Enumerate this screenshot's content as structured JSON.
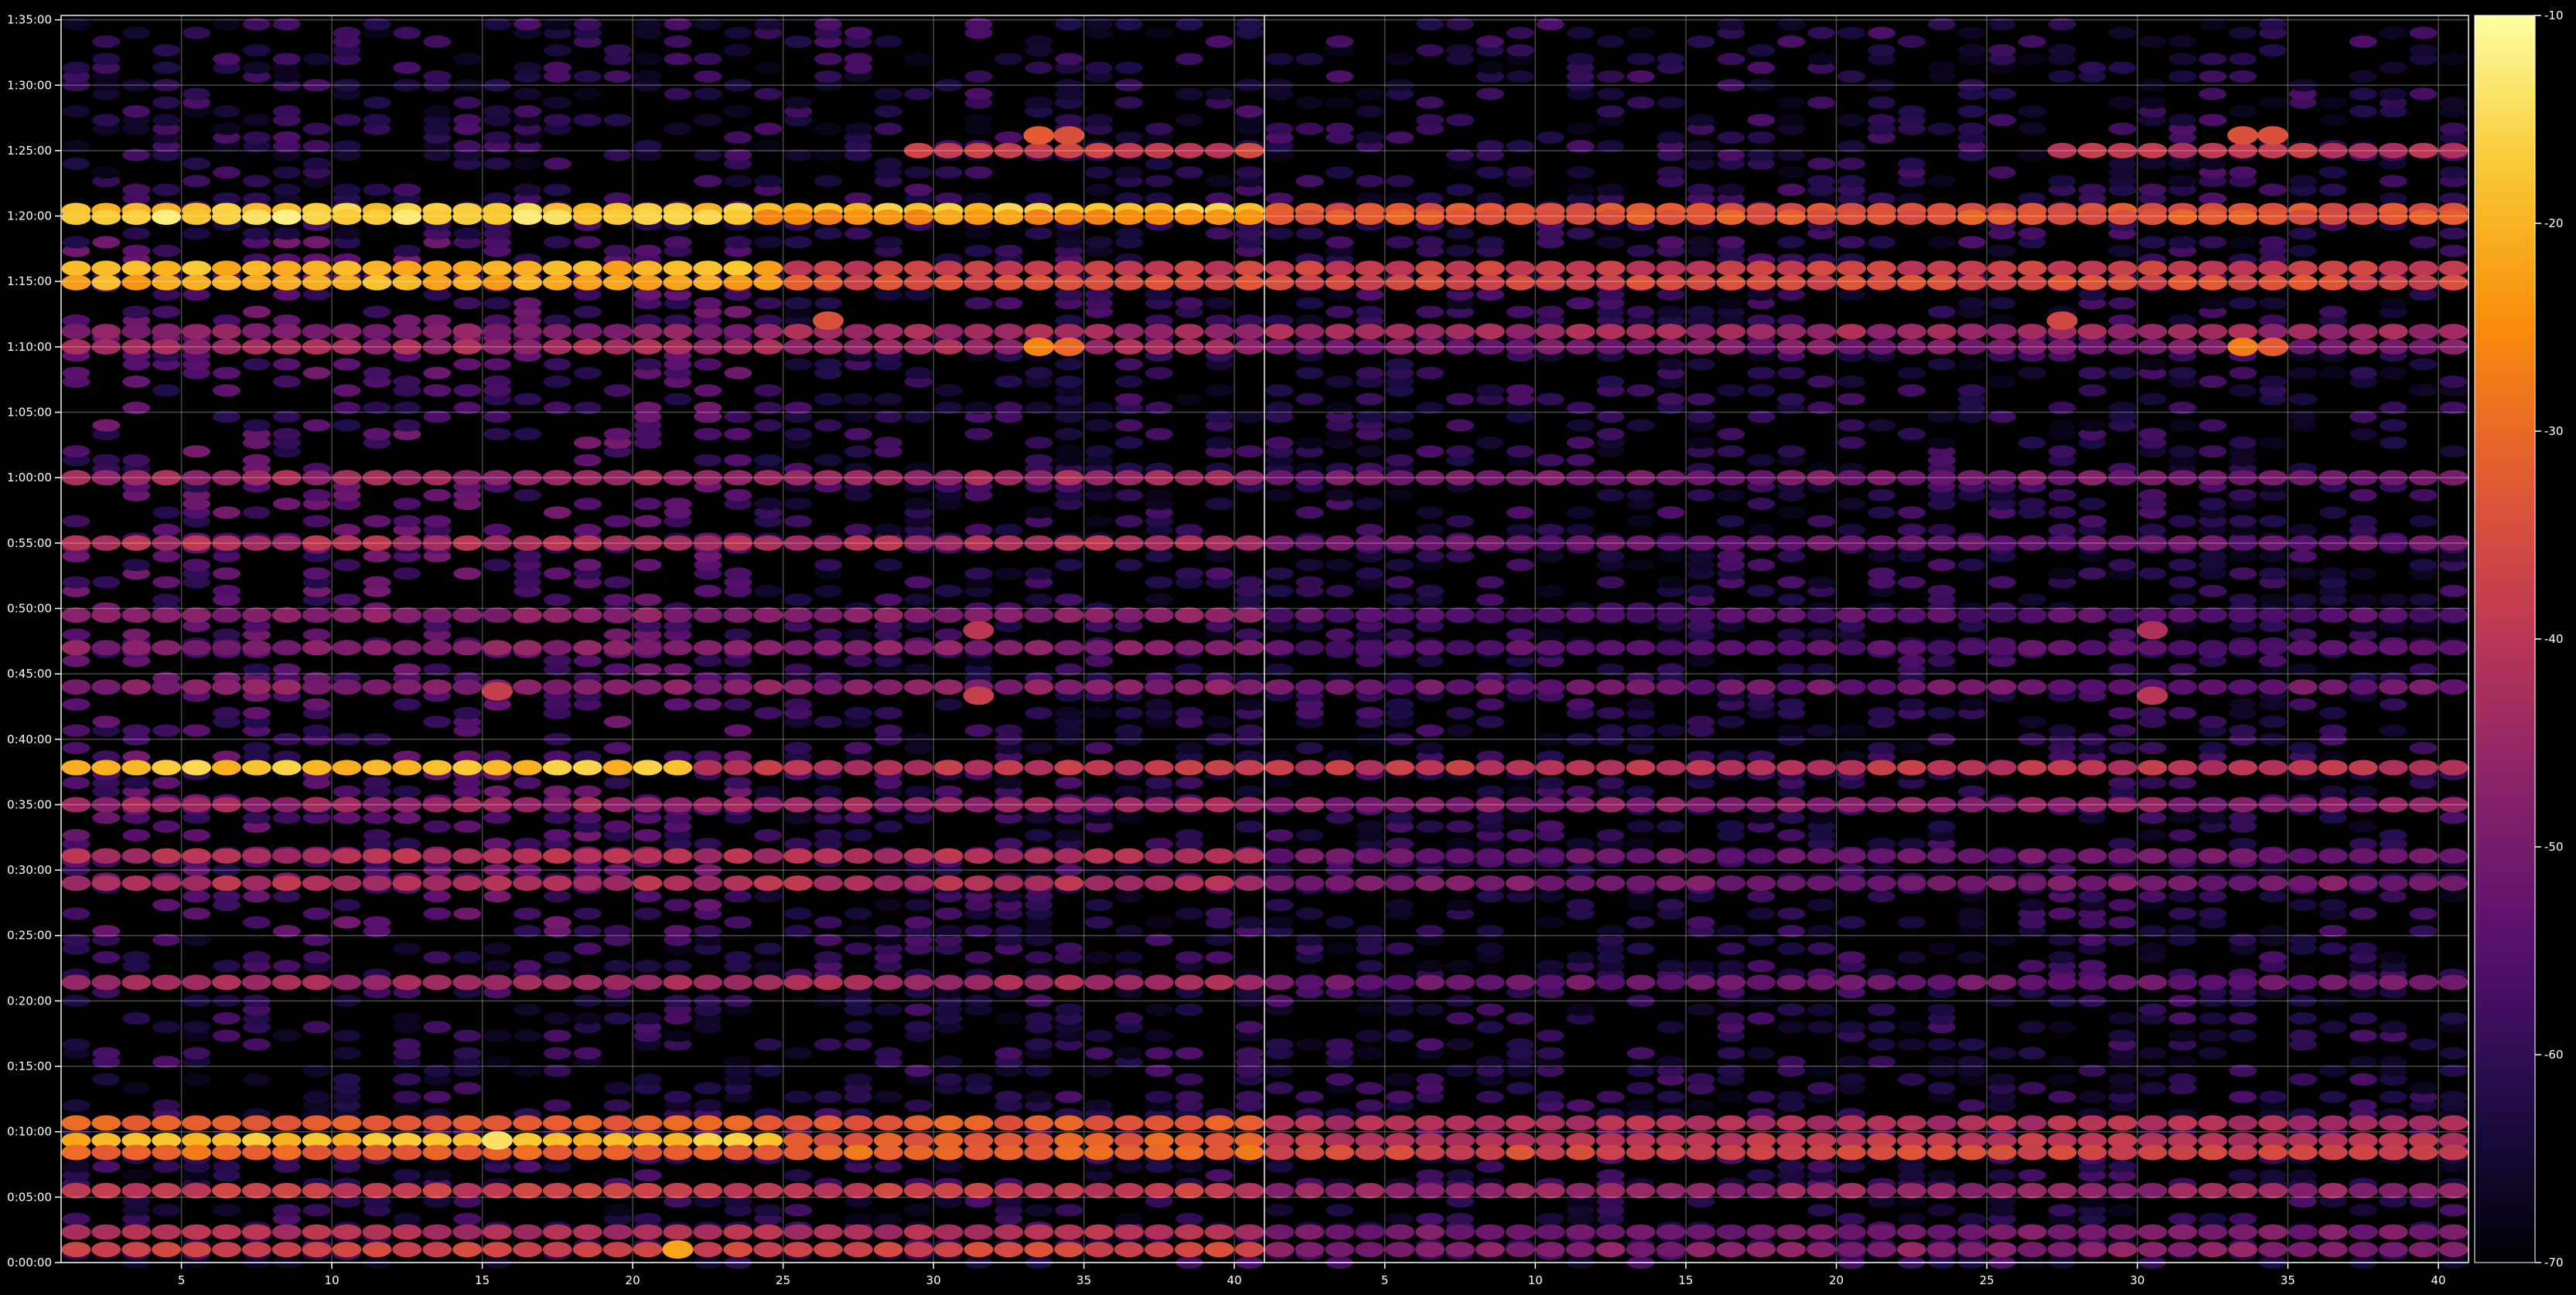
{
  "chart_data": {
    "type": "heatmap",
    "title": "",
    "xlabel": "",
    "ylabel": "",
    "panels": [
      {
        "name": "left",
        "xlim": [
          1,
          40
        ],
        "x_ticks": [
          5,
          10,
          15,
          20,
          25,
          30,
          35,
          40
        ]
      },
      {
        "name": "right",
        "xlim": [
          1,
          40
        ],
        "x_ticks": [
          5,
          10,
          15,
          20,
          25,
          30,
          35,
          40
        ]
      }
    ],
    "y_axis": {
      "unit": "time (h:mm:ss)",
      "min_seconds": 0,
      "max_seconds": 5720,
      "ticks": [
        {
          "s": 0,
          "label": "0:00:00"
        },
        {
          "s": 300,
          "label": "0:05:00"
        },
        {
          "s": 600,
          "label": "0:10:00"
        },
        {
          "s": 900,
          "label": "0:15:00"
        },
        {
          "s": 1200,
          "label": "0:20:00"
        },
        {
          "s": 1500,
          "label": "0:25:00"
        },
        {
          "s": 1800,
          "label": "0:30:00"
        },
        {
          "s": 2100,
          "label": "0:35:00"
        },
        {
          "s": 2400,
          "label": "0:40:00"
        },
        {
          "s": 2700,
          "label": "0:45:00"
        },
        {
          "s": 3000,
          "label": "0:50:00"
        },
        {
          "s": 3300,
          "label": "0:55:00"
        },
        {
          "s": 3600,
          "label": "1:00:00"
        },
        {
          "s": 3900,
          "label": "1:05:00"
        },
        {
          "s": 4200,
          "label": "1:10:00"
        },
        {
          "s": 4500,
          "label": "1:15:00"
        },
        {
          "s": 4800,
          "label": "1:20:00"
        },
        {
          "s": 5100,
          "label": "1:25:00"
        },
        {
          "s": 5400,
          "label": "1:30:00"
        },
        {
          "s": 5700,
          "label": "1:35:00"
        }
      ]
    },
    "colorbar": {
      "colormap": "inferno",
      "range": [
        -70,
        -10
      ],
      "ticks": [
        -10,
        -20,
        -30,
        -40,
        -50,
        -60,
        -70
      ]
    },
    "grid": true,
    "band_note_values": [
      {
        "s": 5100,
        "left": [
          [
            29,
            40,
            -38
          ]
        ],
        "right": [
          [
            27,
            40,
            -40
          ]
        ]
      },
      {
        "s": 4825,
        "left": [
          [
            1,
            40,
            -18
          ]
        ],
        "right": [
          [
            1,
            40,
            -34
          ]
        ]
      },
      {
        "s": 4795,
        "left": [
          [
            1,
            24,
            -15
          ],
          [
            24,
            40,
            -24
          ]
        ],
        "right": [
          [
            1,
            40,
            -33
          ]
        ]
      },
      {
        "s": 4560,
        "left": [
          [
            1,
            25,
            -20
          ],
          [
            25,
            40,
            -38
          ]
        ],
        "right": [
          [
            1,
            40,
            -38
          ]
        ]
      },
      {
        "s": 4495,
        "left": [
          [
            1,
            25,
            -21
          ],
          [
            25,
            40,
            -34
          ]
        ],
        "right": [
          [
            1,
            40,
            -35
          ]
        ]
      },
      {
        "s": 4270,
        "left": [
          [
            1,
            25,
            -48
          ],
          [
            25,
            40,
            -44
          ]
        ],
        "right": [
          [
            1,
            40,
            -44
          ]
        ]
      },
      {
        "s": 4200,
        "left": [
          [
            1,
            40,
            -44
          ]
        ],
        "right": [
          [
            1,
            40,
            -50
          ]
        ]
      },
      {
        "s": 3600,
        "left": [
          [
            1,
            40,
            -44
          ]
        ],
        "right": [
          [
            1,
            40,
            -50
          ]
        ]
      },
      {
        "s": 3300,
        "left": [
          [
            1,
            40,
            -42
          ]
        ],
        "right": [
          [
            1,
            40,
            -52
          ]
        ]
      },
      {
        "s": 2970,
        "left": [
          [
            1,
            40,
            -48
          ]
        ],
        "right": [
          [
            1,
            40,
            -55
          ]
        ]
      },
      {
        "s": 2820,
        "left": [
          [
            1,
            40,
            -48
          ]
        ],
        "right": [
          [
            1,
            40,
            -55
          ]
        ]
      },
      {
        "s": 2640,
        "left": [
          [
            1,
            40,
            -48
          ]
        ],
        "right": [
          [
            1,
            40,
            -52
          ]
        ]
      },
      {
        "s": 2270,
        "left": [
          [
            1,
            22,
            -18
          ],
          [
            22,
            40,
            -40
          ]
        ],
        "right": [
          [
            1,
            40,
            -40
          ]
        ]
      },
      {
        "s": 2100,
        "left": [
          [
            1,
            40,
            -45
          ]
        ],
        "right": [
          [
            1,
            40,
            -48
          ]
        ]
      },
      {
        "s": 1865,
        "left": [
          [
            1,
            40,
            -42
          ]
        ],
        "right": [
          [
            1,
            40,
            -52
          ]
        ]
      },
      {
        "s": 1740,
        "left": [
          [
            1,
            40,
            -42
          ]
        ],
        "right": [
          [
            1,
            40,
            -50
          ]
        ]
      },
      {
        "s": 1285,
        "left": [
          [
            1,
            40,
            -44
          ]
        ],
        "right": [
          [
            1,
            40,
            -52
          ]
        ]
      },
      {
        "s": 640,
        "left": [
          [
            1,
            40,
            -32
          ]
        ],
        "right": [
          [
            1,
            40,
            -42
          ]
        ]
      },
      {
        "s": 560,
        "left": [
          [
            1,
            25,
            -19
          ],
          [
            25,
            40,
            -32
          ]
        ],
        "right": [
          [
            1,
            40,
            -40
          ]
        ]
      },
      {
        "s": 505,
        "left": [
          [
            1,
            40,
            -30
          ]
        ],
        "right": [
          [
            1,
            40,
            -36
          ]
        ]
      },
      {
        "s": 330,
        "left": [
          [
            1,
            40,
            -38
          ]
        ],
        "right": [
          [
            1,
            40,
            -46
          ]
        ]
      },
      {
        "s": 140,
        "left": [
          [
            1,
            40,
            -42
          ]
        ],
        "right": [
          [
            1,
            40,
            -50
          ]
        ]
      },
      {
        "s": 60,
        "left": [
          [
            1,
            40,
            -36
          ]
        ],
        "right": [
          [
            1,
            40,
            -48
          ]
        ]
      }
    ],
    "hot_spots": [
      {
        "panel": "left",
        "x": 33,
        "s": 5170,
        "value": -32
      },
      {
        "panel": "left",
        "x": 34,
        "s": 5170,
        "value": -34
      },
      {
        "panel": "right",
        "x": 33,
        "s": 5170,
        "value": -34
      },
      {
        "panel": "right",
        "x": 34,
        "s": 5170,
        "value": -34
      },
      {
        "panel": "left",
        "x": 33,
        "s": 4200,
        "value": -26
      },
      {
        "panel": "left",
        "x": 34,
        "s": 4200,
        "value": -30
      },
      {
        "panel": "right",
        "x": 33,
        "s": 4200,
        "value": -27
      },
      {
        "panel": "right",
        "x": 34,
        "s": 4200,
        "value": -32
      },
      {
        "panel": "left",
        "x": 26,
        "s": 4320,
        "value": -34
      },
      {
        "panel": "right",
        "x": 27,
        "s": 4320,
        "value": -36
      },
      {
        "panel": "left",
        "x": 31,
        "s": 2900,
        "value": -40
      },
      {
        "panel": "right",
        "x": 30,
        "s": 2900,
        "value": -42
      },
      {
        "panel": "left",
        "x": 15,
        "s": 2620,
        "value": -38
      },
      {
        "panel": "left",
        "x": 31,
        "s": 2600,
        "value": -38
      },
      {
        "panel": "right",
        "x": 30,
        "s": 2600,
        "value": -40
      },
      {
        "panel": "left",
        "x": 21,
        "s": 60,
        "value": -22
      },
      {
        "panel": "left",
        "x": 15,
        "s": 560,
        "value": -14
      }
    ]
  }
}
